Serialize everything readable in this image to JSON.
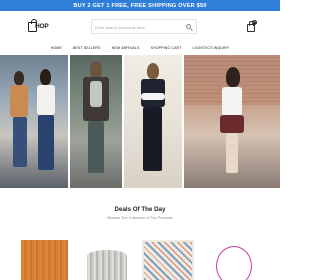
{
  "promo_bar": {
    "text": "BUY 2 GET 1 FREE, FREE SHIPPING OVER $50"
  },
  "header": {
    "logo_text": "HOP",
    "search_placeholder": "Enter search keywords here",
    "cart_count": "0"
  },
  "nav": {
    "items": [
      "HOME",
      "BEST SELLERS",
      "NEW ARRIVALS",
      "SHOPPING CART",
      "LOGISTICS INQUIRY"
    ]
  },
  "deals": {
    "title": "Deals Of The Day",
    "subtitle": "Browse The Collection of Top Products"
  },
  "colors": {
    "promo_bar_bg": "#2f7fd8",
    "text_dark": "#222222"
  }
}
